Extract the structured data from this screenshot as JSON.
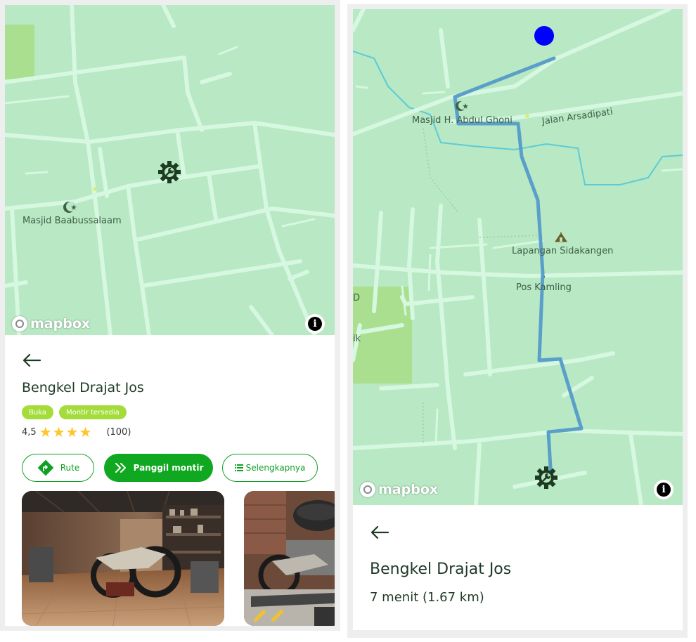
{
  "left": {
    "map": {
      "labels": {
        "mosque": "Masjid Baabussalaam"
      },
      "attribution": "mapbox",
      "info": "i"
    },
    "shop": {
      "name": "Bengkel Drajat Jos",
      "badges": [
        "Buka",
        "Montir tersedia"
      ],
      "rating": "4,5",
      "stars": 4,
      "reviews": "(100)"
    },
    "actions": {
      "route": "Rute",
      "call": "Panggil montir",
      "more": "Selengkapnya"
    }
  },
  "right": {
    "map": {
      "labels": {
        "mosque": "Masjid H. Abdul Ghoni",
        "street": "Jalan Arsadipati",
        "field": "Lapangan Sidakangen",
        "post": "Pos Kamling",
        "edge1": "D",
        "edge2": "ik"
      },
      "attribution": "mapbox",
      "info": "i"
    },
    "shop": {
      "name": "Bengkel Drajat Jos",
      "eta": "7 menit (1.67 km)"
    }
  },
  "colors": {
    "map_bg": "#b8e8c4",
    "road": "#d6f7e0",
    "water": "#5ccbd6",
    "park": "#a9df8e",
    "route": "#5a9fc9",
    "primary_green": "#10a820",
    "badge_green": "#a4dc3c",
    "star": "#ffc62b",
    "marker": "#1d3b22",
    "user_location": "#0000ff"
  },
  "icons": {
    "workshop": "gear-wrench-icon",
    "mosque": "crescent-star-icon",
    "back": "arrow-left-icon",
    "route": "turn-right-diamond-icon",
    "call": "double-chevron-right-icon",
    "more": "list-icon",
    "field": "tent-icon"
  }
}
